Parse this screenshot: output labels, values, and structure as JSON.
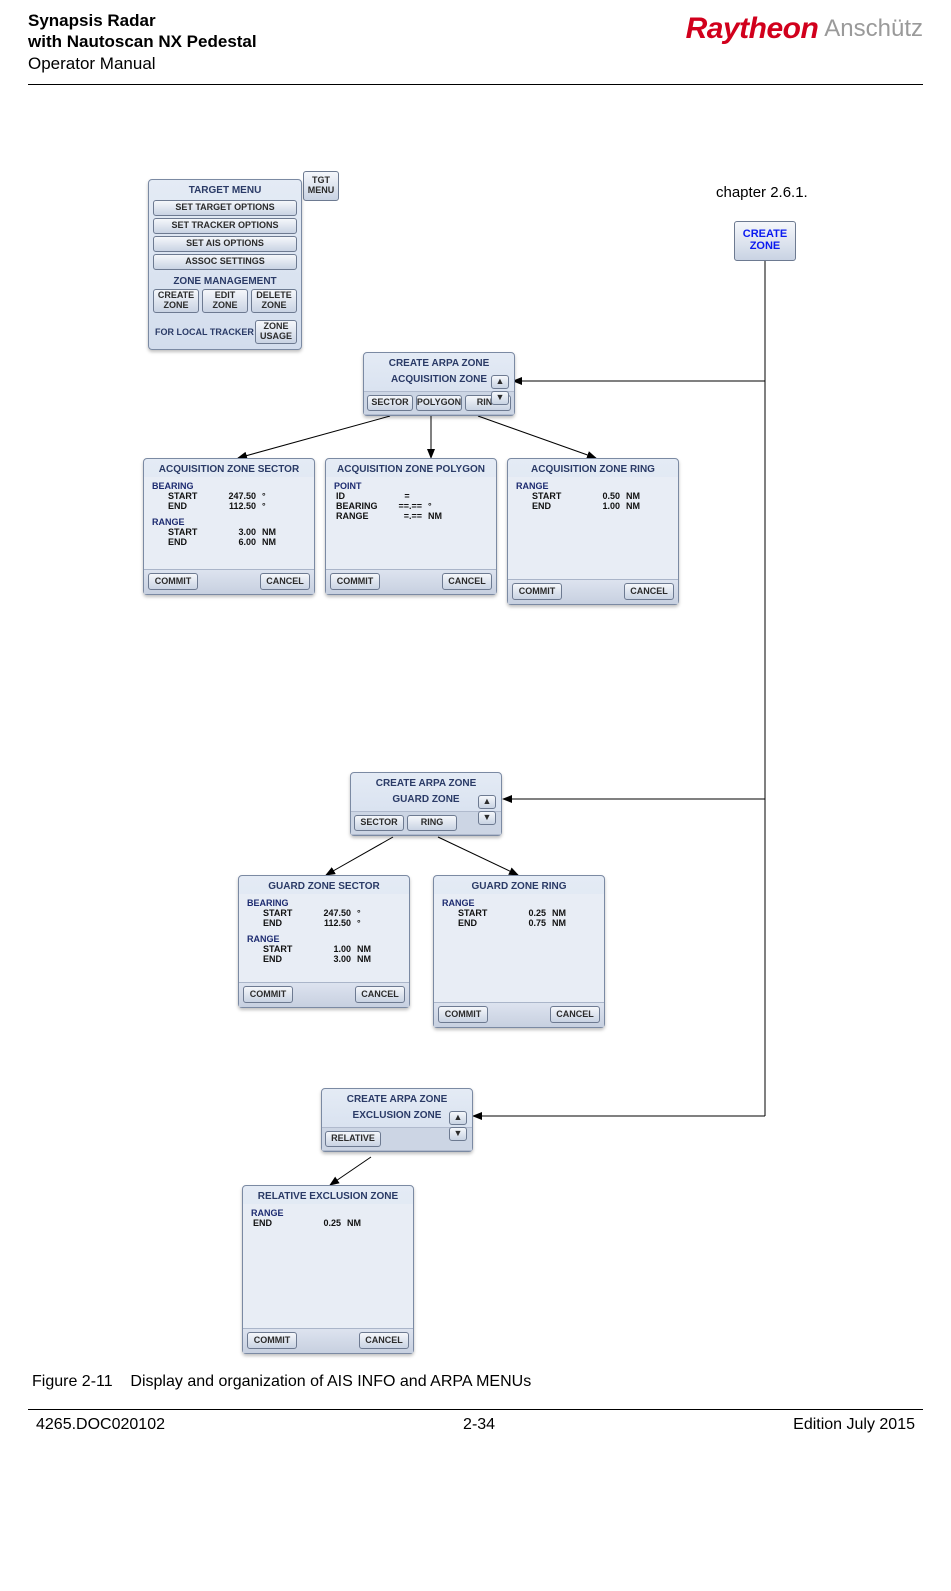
{
  "header": {
    "line1": "Synapsis Radar",
    "line2": "with Nautoscan NX Pedestal",
    "line3": "Operator Manual",
    "brand1": "Raytheon",
    "brand2": "Anschütz"
  },
  "chapter_ref": "chapter 2.6.1.",
  "tgt_menu_btn": "TGT\nMENU",
  "create_zone_btn": "CREATE\nZONE",
  "target_menu": {
    "title": "TARGET MENU",
    "items": [
      "SET TARGET OPTIONS",
      "SET TRACKER OPTIONS",
      "SET AIS OPTIONS",
      "ASSOC SETTINGS"
    ],
    "zone_mgmt": "ZONE MANAGEMENT",
    "zone_row": [
      "CREATE\nZONE",
      "EDIT\nZONE",
      "DELETE\nZONE"
    ],
    "local_tracker": "FOR LOCAL TRACKER",
    "usage_btn": "ZONE\nUSAGE"
  },
  "create_acq": {
    "title": "CREATE ARPA ZONE",
    "subtitle": "ACQUISITION ZONE",
    "tabs": [
      "SECTOR",
      "POLYGON",
      "RING"
    ]
  },
  "acq_sector": {
    "title": "ACQUISITION ZONE SECTOR",
    "bearing": "BEARING",
    "b_start_l": "START",
    "b_start_v": "247.50",
    "b_start_u": "°",
    "b_end_l": "END",
    "b_end_v": "112.50",
    "b_end_u": "°",
    "range": "RANGE",
    "r_start_l": "START",
    "r_start_v": "3.00",
    "r_start_u": "NM",
    "r_end_l": "END",
    "r_end_v": "6.00",
    "r_end_u": "NM",
    "commit": "COMMIT",
    "cancel": "CANCEL"
  },
  "acq_polygon": {
    "title": "ACQUISITION ZONE POLYGON",
    "point": "POINT",
    "id_l": "ID",
    "id_v": "=",
    "brg_l": "BEARING",
    "brg_v": "==.==",
    "brg_u": "°",
    "rng_l": "RANGE",
    "rng_v": "=.==",
    "rng_u": "NM",
    "commit": "COMMIT",
    "cancel": "CANCEL"
  },
  "acq_ring": {
    "title": "ACQUISITION ZONE RING",
    "range": "RANGE",
    "r_start_l": "START",
    "r_start_v": "0.50",
    "r_start_u": "NM",
    "r_end_l": "END",
    "r_end_v": "1.00",
    "r_end_u": "NM",
    "commit": "COMMIT",
    "cancel": "CANCEL"
  },
  "create_guard": {
    "title": "CREATE ARPA ZONE",
    "subtitle": "GUARD ZONE",
    "tabs": [
      "SECTOR",
      "RING"
    ]
  },
  "guard_sector": {
    "title": "GUARD ZONE SECTOR",
    "bearing": "BEARING",
    "b_start_l": "START",
    "b_start_v": "247.50",
    "b_start_u": "°",
    "b_end_l": "END",
    "b_end_v": "112.50",
    "b_end_u": "°",
    "range": "RANGE",
    "r_start_l": "START",
    "r_start_v": "1.00",
    "r_start_u": "NM",
    "r_end_l": "END",
    "r_end_v": "3.00",
    "r_end_u": "NM",
    "commit": "COMMIT",
    "cancel": "CANCEL"
  },
  "guard_ring": {
    "title": "GUARD ZONE RING",
    "range": "RANGE",
    "r_start_l": "START",
    "r_start_v": "0.25",
    "r_start_u": "NM",
    "r_end_l": "END",
    "r_end_v": "0.75",
    "r_end_u": "NM",
    "commit": "COMMIT",
    "cancel": "CANCEL"
  },
  "create_excl": {
    "title": "CREATE ARPA ZONE",
    "subtitle": "EXCLUSION ZONE",
    "tabs": [
      "RELATIVE"
    ]
  },
  "rel_excl": {
    "title": "RELATIVE EXCLUSION ZONE",
    "range": "RANGE",
    "r_end_l": "END",
    "r_end_v": "0.25",
    "r_end_u": "NM",
    "commit": "COMMIT",
    "cancel": "CANCEL"
  },
  "figure_num": "Figure 2-11",
  "figure_text": "Display and organization of AIS INFO and ARPA MENUs",
  "footer": {
    "doc": "4265.DOC020102",
    "page": "2-34",
    "edition": "Edition July 2015"
  }
}
